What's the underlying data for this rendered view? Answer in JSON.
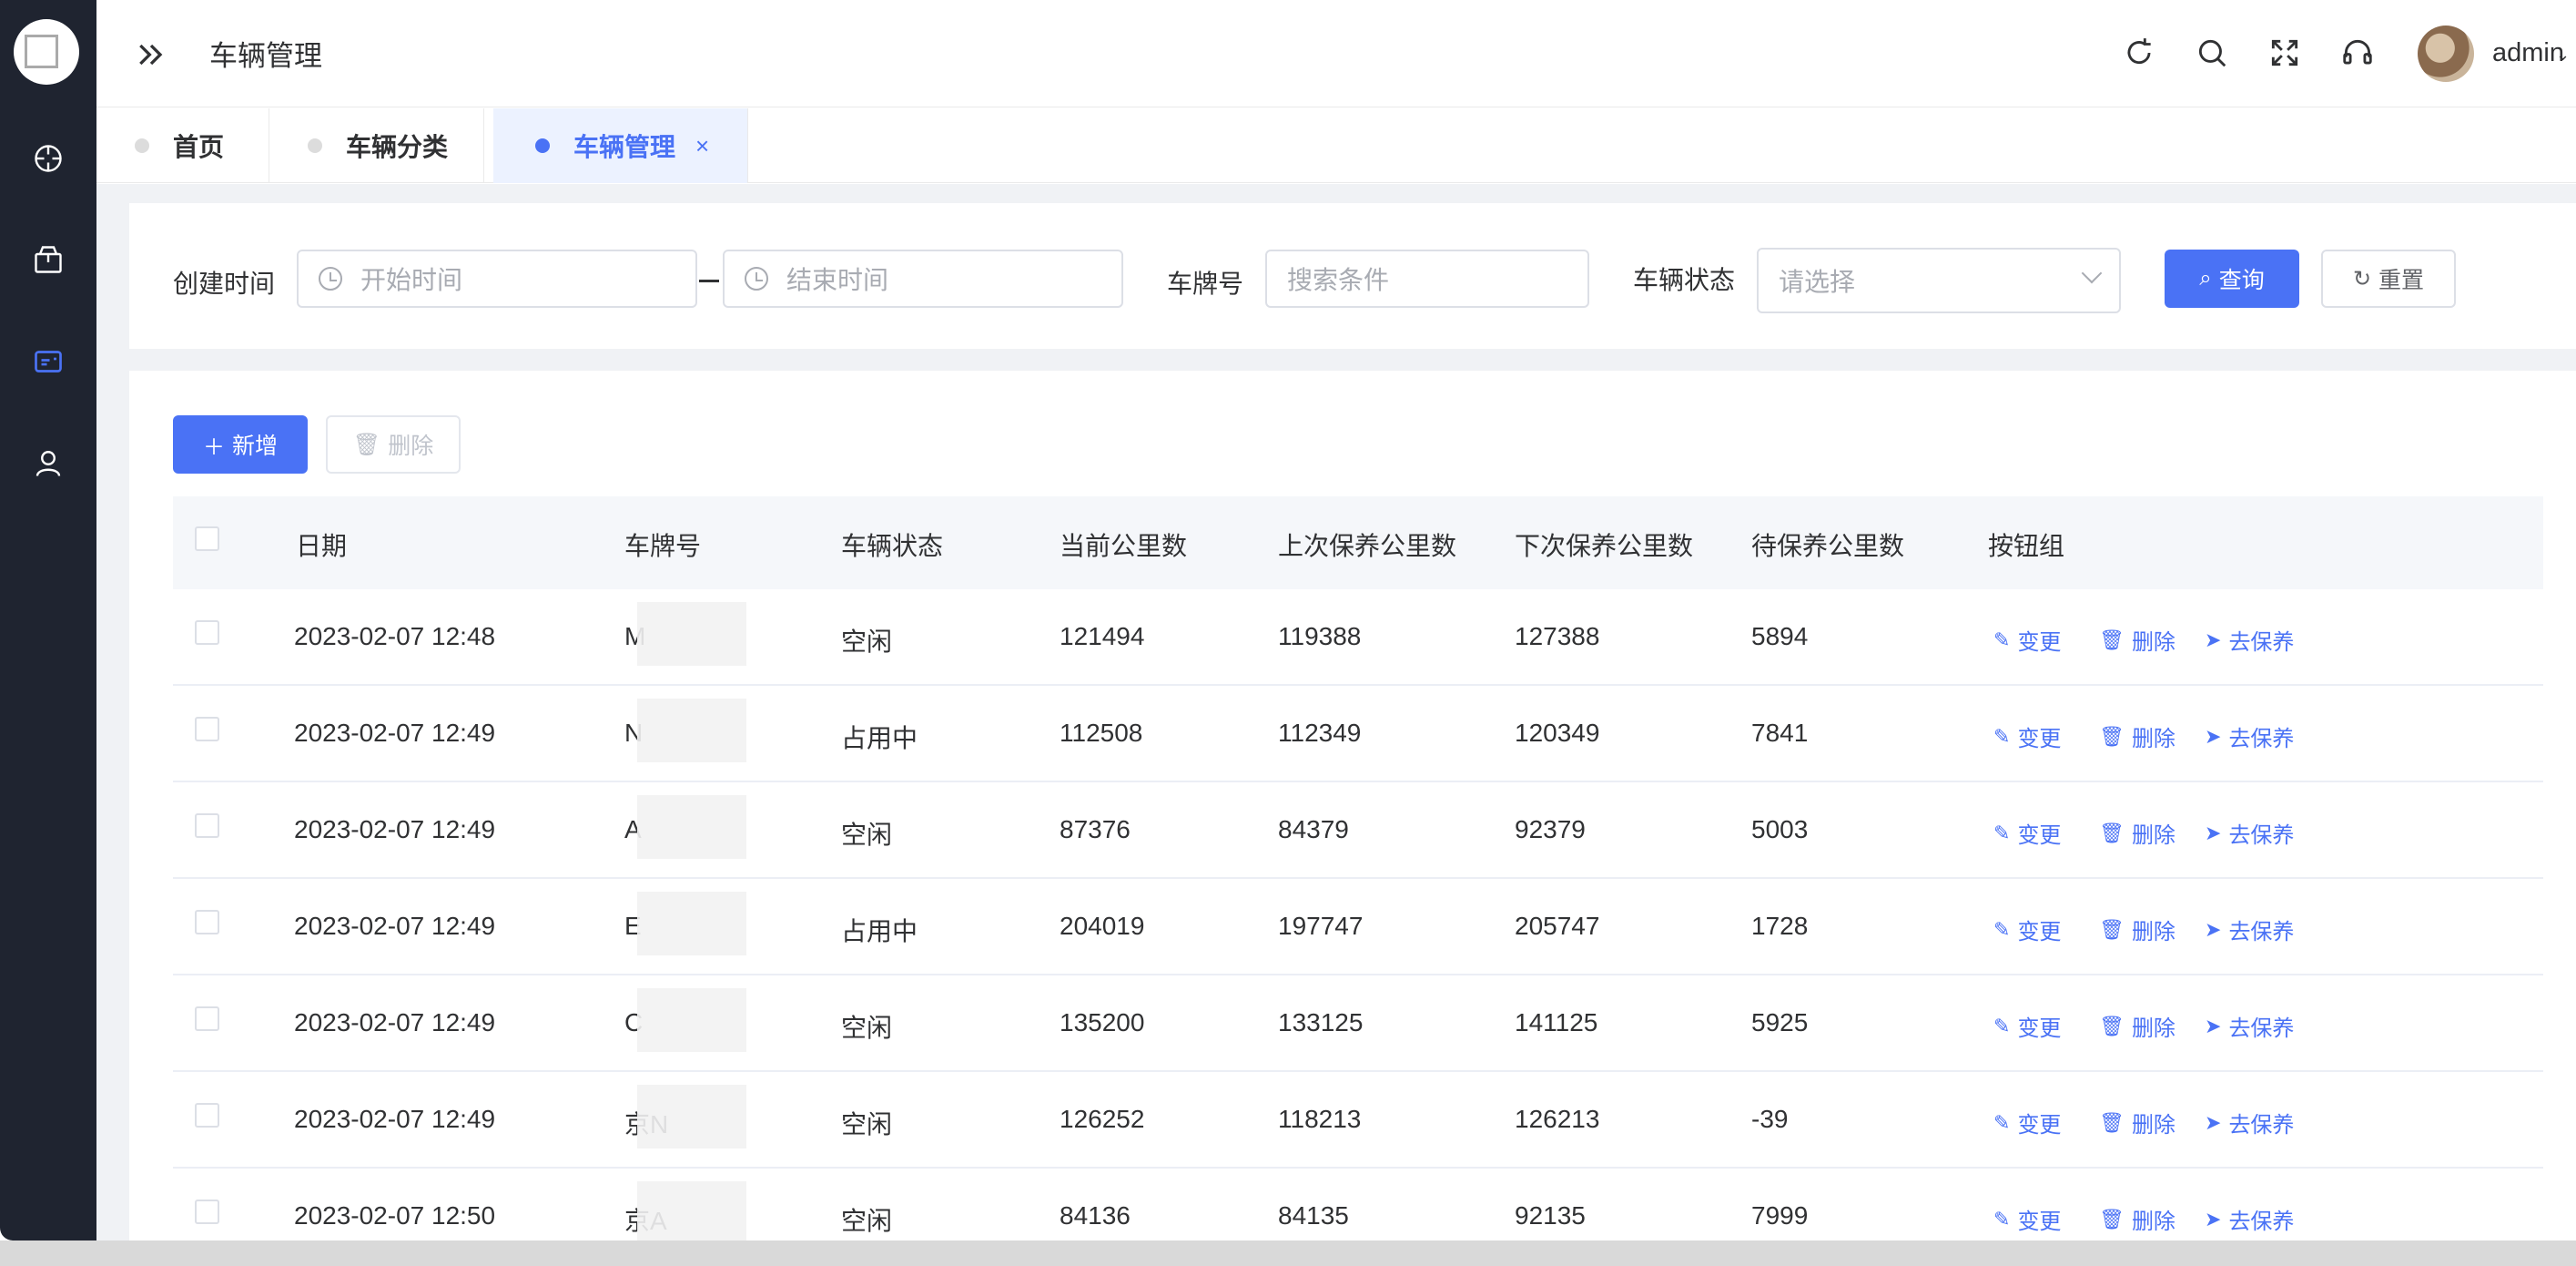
{
  "header": {
    "title": "车辆管理",
    "username": "admin"
  },
  "tabs": [
    {
      "label": "首页"
    },
    {
      "label": "车辆分类"
    },
    {
      "label": "车辆管理",
      "close": "×"
    }
  ],
  "filter": {
    "created_label": "创建时间",
    "start_placeholder": "开始时间",
    "end_placeholder": "结束时间",
    "plate_label": "车牌号",
    "plate_placeholder": "搜索条件",
    "status_label": "车辆状态",
    "status_placeholder": "请选择",
    "query_label": "查询",
    "reset_label": "重置"
  },
  "toolbar": {
    "add_label": "新增",
    "delete_label": "删除"
  },
  "table": {
    "columns": [
      "日期",
      "车牌号",
      "车辆状态",
      "当前公里数",
      "上次保养公里数",
      "下次保养公里数",
      "待保养公里数",
      "按钮组"
    ],
    "actions": {
      "edit": "变更",
      "delete": "删除",
      "maintain": "去保养"
    },
    "rows": [
      {
        "date": "2023-02-07 12:48",
        "plate": "M",
        "status": "空闲",
        "current": "121494",
        "last": "119388",
        "next": "127388",
        "pending": "5894"
      },
      {
        "date": "2023-02-07 12:49",
        "plate": "N",
        "status": "占用中",
        "current": "112508",
        "last": "112349",
        "next": "120349",
        "pending": "7841"
      },
      {
        "date": "2023-02-07 12:49",
        "plate": "A",
        "status": "空闲",
        "current": "87376",
        "last": "84379",
        "next": "92379",
        "pending": "5003"
      },
      {
        "date": "2023-02-07 12:49",
        "plate": "E",
        "status": "占用中",
        "current": "204019",
        "last": "197747",
        "next": "205747",
        "pending": "1728"
      },
      {
        "date": "2023-02-07 12:49",
        "plate": "C",
        "status": "空闲",
        "current": "135200",
        "last": "133125",
        "next": "141125",
        "pending": "5925"
      },
      {
        "date": "2023-02-07 12:49",
        "plate": "京N",
        "status": "空闲",
        "current": "126252",
        "last": "118213",
        "next": "126213",
        "pending": "-39"
      },
      {
        "date": "2023-02-07 12:50",
        "plate": "京A",
        "status": "空闲",
        "current": "84136",
        "last": "84135",
        "next": "92135",
        "pending": "7999"
      }
    ]
  },
  "colors": {
    "primary": "#4a72f5",
    "sidebar": "#1f2430",
    "tab_active_bg": "#ecf2ff"
  },
  "icons": {
    "sidebar": [
      "dashboard-icon",
      "package-icon",
      "card-icon",
      "user-icon"
    ],
    "header": [
      "refresh-icon",
      "search-icon",
      "fullscreen-icon",
      "headset-icon"
    ]
  }
}
